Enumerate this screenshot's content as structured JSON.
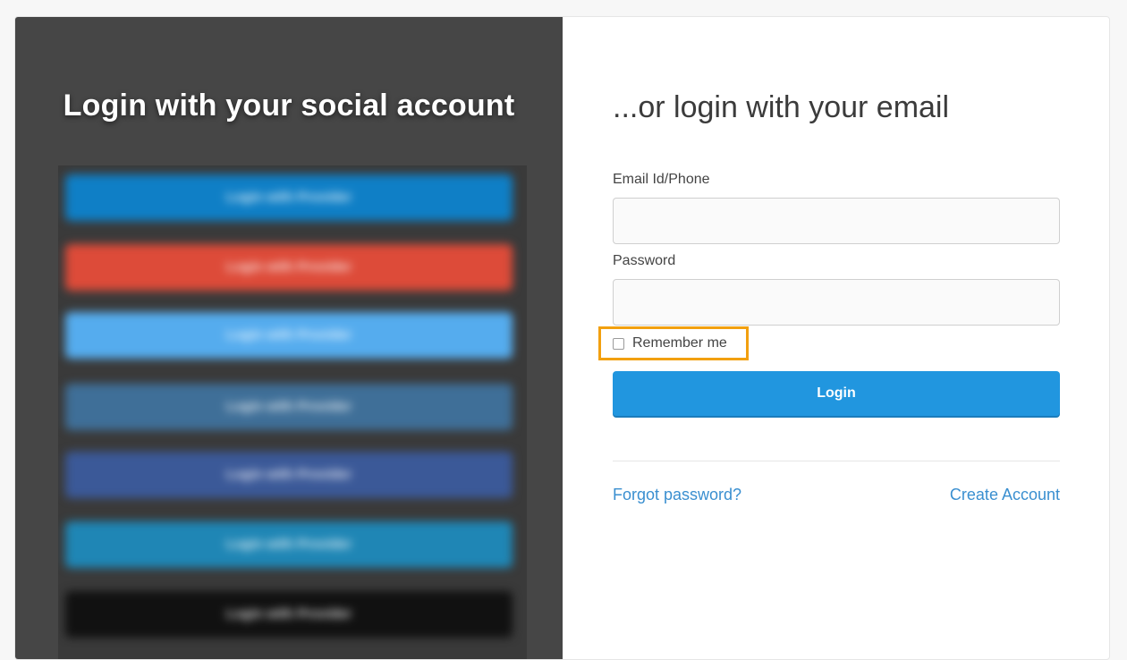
{
  "left": {
    "title": "Login with your social account",
    "social_buttons": [
      {
        "label": "Login with Provider",
        "color": "#0f7fc6"
      },
      {
        "label": "Login with Provider",
        "color": "#dd4b39"
      },
      {
        "label": "Login with Provider",
        "color": "#55acee"
      },
      {
        "label": "Login with Provider",
        "color": "#3f6f98"
      },
      {
        "label": "Login with Provider",
        "color": "#3b5998"
      },
      {
        "label": "Login with Provider",
        "color": "#1f86b5"
      },
      {
        "label": "Login with Provider",
        "color": "#111111"
      }
    ]
  },
  "right": {
    "title": "...or login with your email",
    "email_label": "Email Id/Phone",
    "email_value": "",
    "password_label": "Password",
    "password_value": "",
    "remember_label": "Remember me",
    "login_label": "Login",
    "forgot_label": "Forgot password?",
    "create_label": "Create Account"
  },
  "colors": {
    "accent": "#2196df",
    "highlight": "#f2a00f",
    "link": "#3a8fd0"
  }
}
